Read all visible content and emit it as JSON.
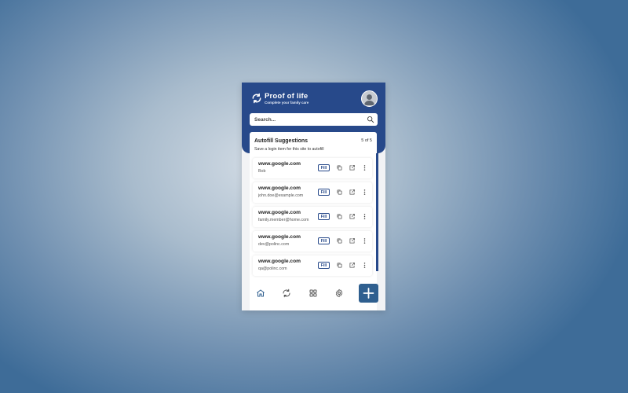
{
  "header": {
    "title": "Proof of life",
    "subtitle": "Complete your family care",
    "logo_icon": "sync-arrows-icon",
    "avatar_icon": "user-avatar-icon"
  },
  "search": {
    "placeholder": "Search..."
  },
  "autofill": {
    "title": "Autofill Suggestions",
    "count": "5 of 5",
    "subtitle": "Save a login item for this site to autofill",
    "items": [
      {
        "host": "www.google.com",
        "user": "Bob",
        "fill_label": "Fill"
      },
      {
        "host": "www.google.com",
        "user": "john.doe@example.com",
        "fill_label": "Fill"
      },
      {
        "host": "www.google.com",
        "user": "family.member@home.com",
        "fill_label": "Fill"
      },
      {
        "host": "www.google.com",
        "user": "dev@polinc.com",
        "fill_label": "Fill"
      },
      {
        "host": "www.google.com",
        "user": "qa@polinc.com",
        "fill_label": "Fill"
      }
    ]
  },
  "bottom_nav": {
    "items": [
      "home-icon",
      "sync-icon",
      "grid-icon",
      "settings-icon"
    ],
    "add_icon": "plus-icon"
  },
  "colors": {
    "brand": "#27498a",
    "accent": "#2f5f8f"
  }
}
